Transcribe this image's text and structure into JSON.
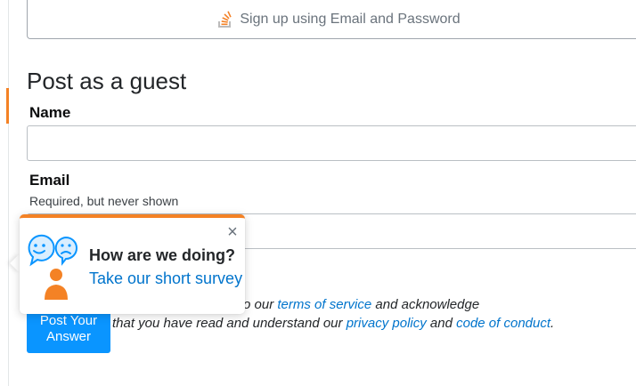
{
  "signup": {
    "label": "Sign up using Email and Password",
    "icon": "stackoverflow-logo-icon"
  },
  "guest": {
    "heading": "Post as a guest",
    "name_label": "Name",
    "name_value": "",
    "email_label": "Email",
    "email_hint": "Required, but never shown",
    "email_value": ""
  },
  "post_button": {
    "label": "Post Your Answer"
  },
  "agreement": {
    "line1_prefix": "r Answer”, you agree to our ",
    "terms_link": "terms of service",
    "line1_suffix": " and acknowledge",
    "line2_prefix": "that you have read and understand our ",
    "privacy_link": "privacy policy",
    "and": " and ",
    "conduct_link": "code of conduct",
    "period": "."
  },
  "survey_popup": {
    "title": "How are we doing?",
    "link": "Take our short survey",
    "close": "×",
    "accent": "#f48225"
  },
  "colors": {
    "link": "#0074cc",
    "primary_button": "#0a95ff",
    "accent": "#f48225"
  }
}
